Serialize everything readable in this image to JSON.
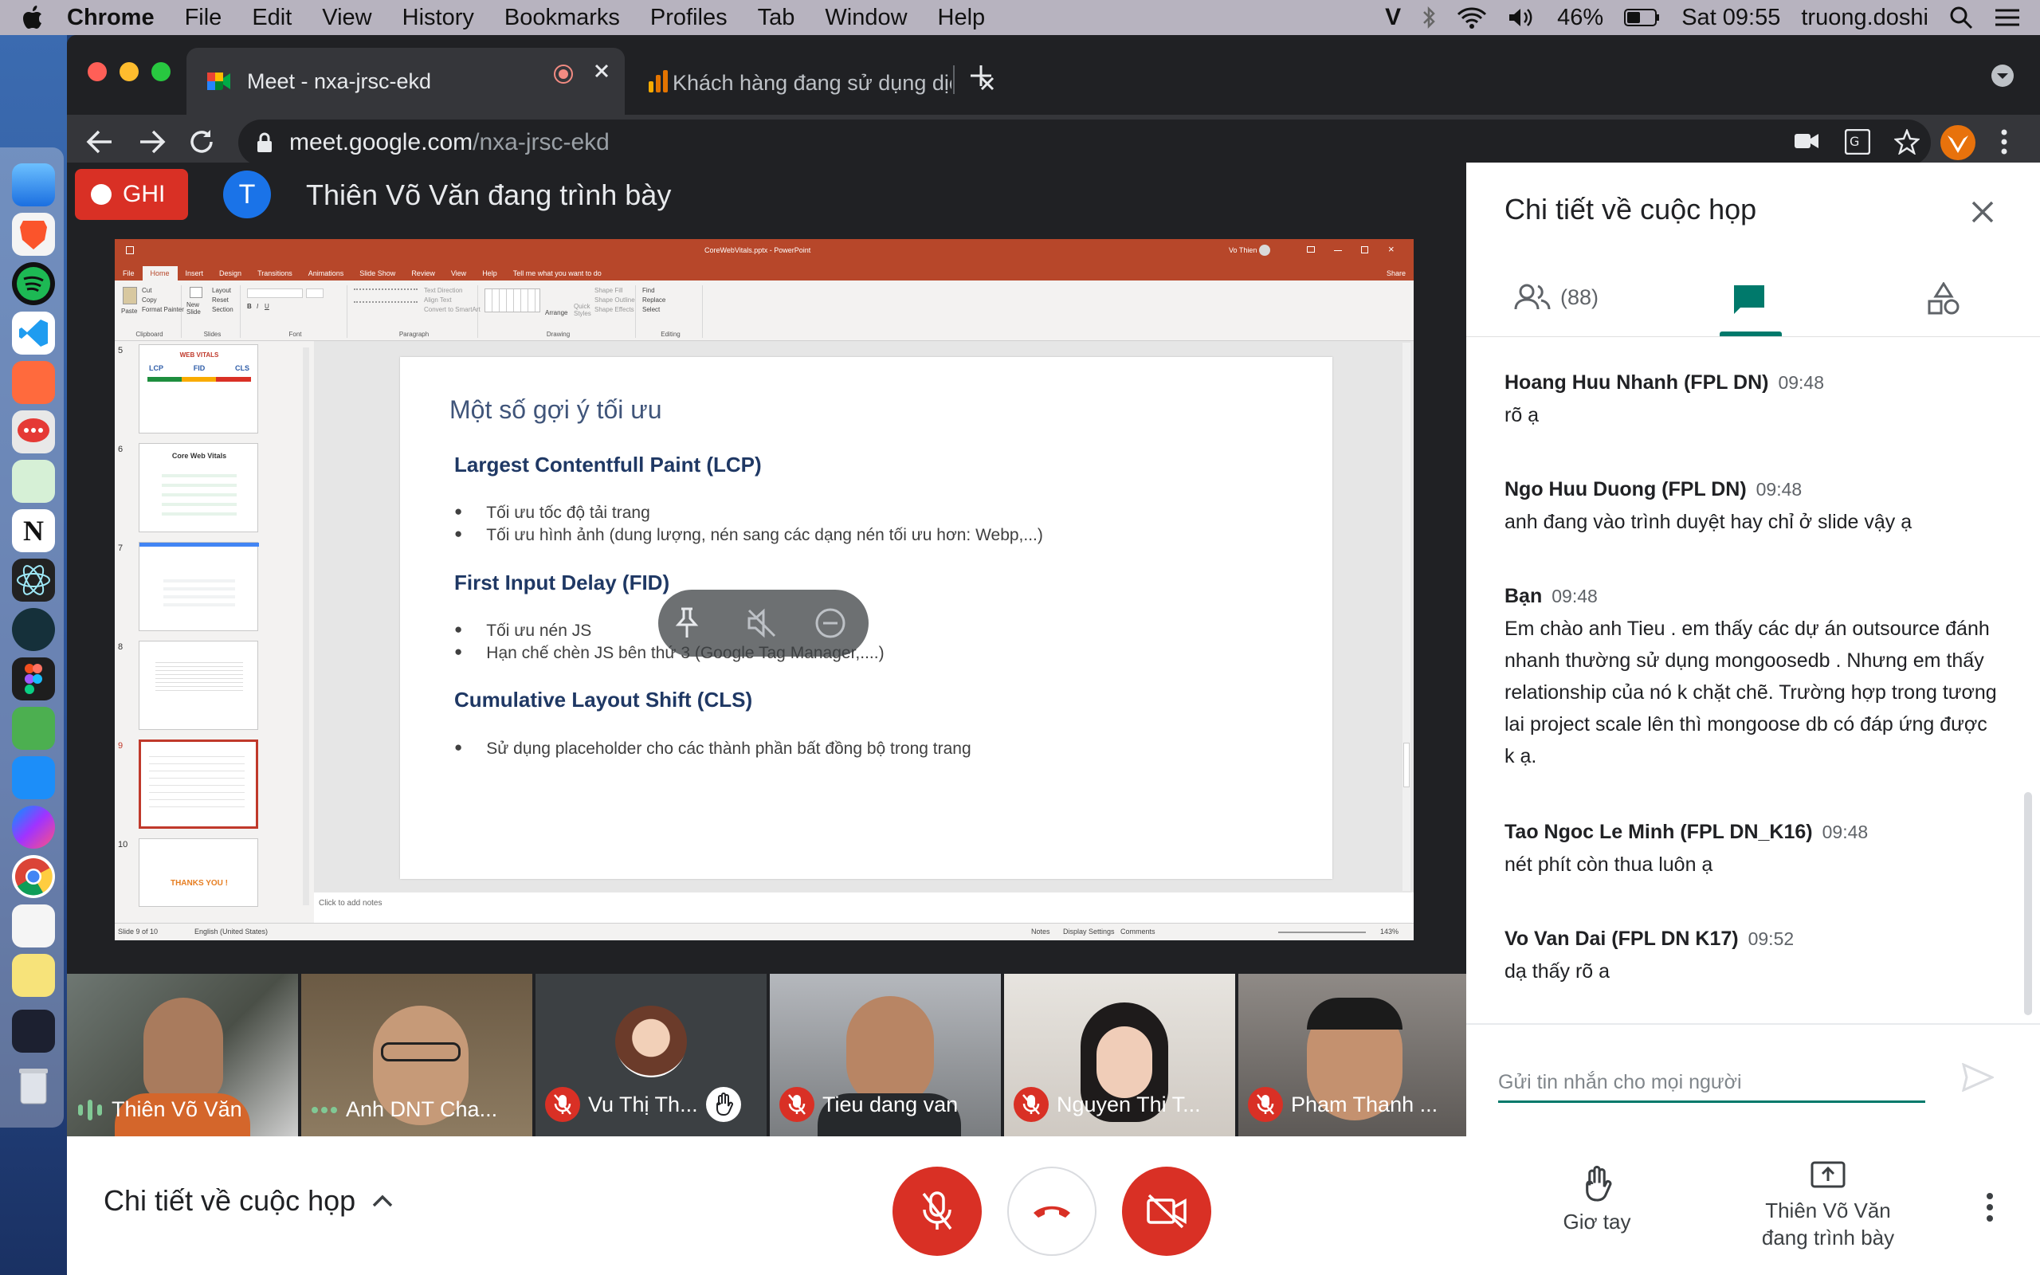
{
  "menubar": {
    "app": "Chrome",
    "items": [
      "File",
      "Edit",
      "View",
      "History",
      "Bookmarks",
      "Profiles",
      "Tab",
      "Window",
      "Help"
    ],
    "battery": "46%",
    "clock": "Sat 09:55",
    "user": "truong.doshi"
  },
  "browser": {
    "tabs": [
      {
        "title": "Meet - nxa-jrsc-ekd"
      },
      {
        "title": "Khách hàng đang sử dụng dịch"
      }
    ],
    "url_host": "meet.google.com",
    "url_path": "/nxa-jrsc-ekd"
  },
  "meet": {
    "record_label": "GHI",
    "presenter_avatar": "T",
    "presenting_text": "Thiên Võ Văn đang trình bày"
  },
  "powerpoint": {
    "filename": "CoreWebVitals.pptx - PowerPoint",
    "user": "Vo Thien",
    "tabs": [
      "File",
      "Home",
      "Insert",
      "Design",
      "Transitions",
      "Animations",
      "Slide Show",
      "Review",
      "View",
      "Help",
      "Tell me what you want to do"
    ],
    "share": "Share",
    "groups": [
      "Clipboard",
      "Slides",
      "Font",
      "Paragraph",
      "Drawing",
      "Editing"
    ],
    "ribbon": {
      "paste": "Paste",
      "cut": "Cut",
      "copy": "Copy",
      "format_painter": "Format Painter",
      "new_slide": "New Slide",
      "layout": "Layout",
      "reset": "Reset",
      "section": "Section",
      "text_direction": "Text Direction",
      "align_text": "Align Text",
      "convert_smartart": "Convert to SmartArt",
      "arrange": "Arrange",
      "quick_styles": "Quick Styles",
      "shape_fill": "Shape Fill",
      "shape_outline": "Shape Outline",
      "shape_effects": "Shape Effects",
      "find": "Find",
      "replace": "Replace",
      "select": "Select"
    },
    "thumb_numbers": [
      "5",
      "6",
      "7",
      "8",
      "9",
      "10"
    ],
    "thumb_texts": {
      "t5_title": "WEB VITALS",
      "t5_labels": [
        "LCP",
        "FID",
        "CLS"
      ],
      "t6_title": "Core Web Vitals",
      "t10_title": "THANKS YOU !"
    },
    "slide": {
      "title": "Một số gợi ý tối ưu",
      "sections": [
        {
          "heading": "Largest Contentfull Paint (LCP)",
          "bullets": [
            "Tối ưu tốc độ tải trang",
            "Tối ưu hình ảnh (dung lượng, nén sang các dạng nén tối ưu hơn: Webp,...)"
          ]
        },
        {
          "heading": "First Input Delay (FID)",
          "bullets": [
            "Tối ưu nén JS",
            "Hạn chế chèn JS bên thứ 3 (Google Tag Manager,....)"
          ]
        },
        {
          "heading": "Cumulative Layout Shift (CLS)",
          "bullets": [
            "Sử dụng placeholder cho các thành phần bất đồng bộ trong trang"
          ]
        }
      ]
    },
    "notes_placeholder": "Click to add notes",
    "status_slide": "Slide 9 of 10",
    "status_lang": "English (United States)",
    "status_notes": "Notes",
    "status_display": "Display Settings",
    "status_comments": "Comments",
    "zoom": "143%"
  },
  "participants": [
    {
      "name": "Thiên Võ Văn",
      "state": "speaking"
    },
    {
      "name": "Anh DNT Cha...",
      "state": "more"
    },
    {
      "name": "Vu Thị Th...",
      "state": "muted"
    },
    {
      "name": "Tieu dang van",
      "state": "muted"
    },
    {
      "name": "Nguyen Thi T...",
      "state": "muted"
    },
    {
      "name": "Pham Thanh ...",
      "state": "muted"
    }
  ],
  "panel": {
    "title": "Chi tiết về cuộc họp",
    "people_count": "(88)",
    "messages": [
      {
        "sender": "Hoang Huu Nhanh (FPL DN)",
        "time": "09:48",
        "text": "rõ ạ"
      },
      {
        "sender": "Ngo Huu Duong (FPL DN)",
        "time": "09:48",
        "text": "anh đang vào trình duyệt hay chỉ ở slide vậy ạ"
      },
      {
        "sender": "Bạn",
        "time": "09:48",
        "text": "Em chào anh Tieu . em thấy các dự án outsource đánh nhanh thường sử dụng mongoosedb . Nhưng em thấy relationship của nó k chặt chẽ. Trường hợp trong tương lai project scale lên thì mongoose db có đáp ứng được k ạ."
      },
      {
        "sender": "Tao Ngoc Le Minh (FPL DN_K16)",
        "time": "09:48",
        "text": "nét phít còn thua luôn ạ"
      },
      {
        "sender": "Vo Van Dai (FPL DN K17)",
        "time": "09:52",
        "text": "dạ thấy rõ a"
      }
    ],
    "input_placeholder": "Gửi tin nhắn cho mọi người"
  },
  "bottombar": {
    "details_label": "Chi tiết về cuộc họp",
    "raise_hand": "Giơ tay",
    "presenting_line1": "Thiên Võ Văn",
    "presenting_line2": "đang trình bày"
  },
  "colors": {
    "meet_red": "#d93025",
    "meet_green": "#00796b",
    "ppt_orange": "#b7472a"
  }
}
